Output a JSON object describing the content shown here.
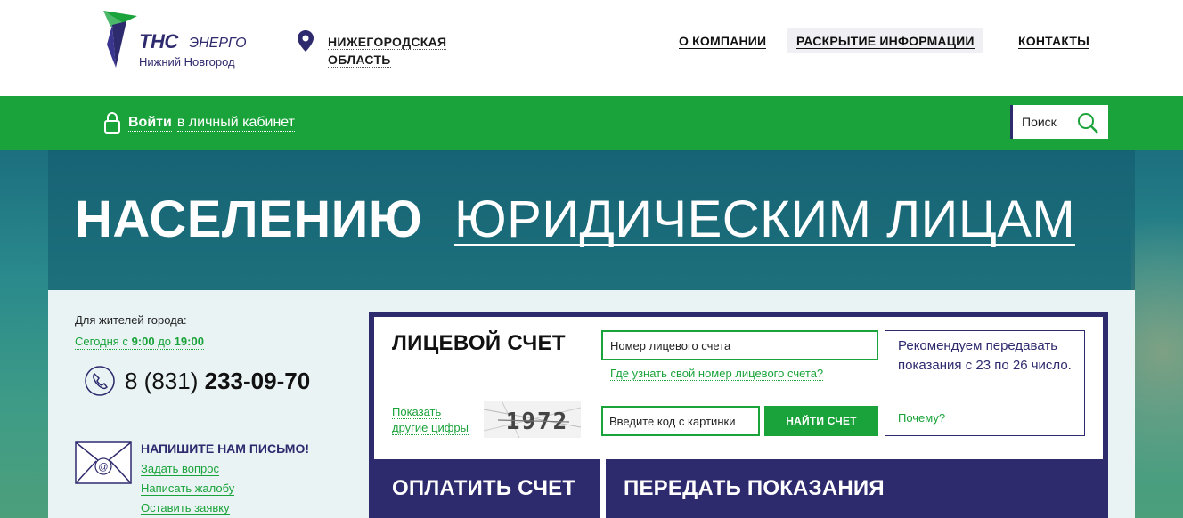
{
  "header": {
    "logo": {
      "brand": "ТНС",
      "brand_suffix": "ЭНЕРГО",
      "city": "Нижний Новгород"
    },
    "region": {
      "line1": "НИЖЕГОРОДСКАЯ",
      "line2": "ОБЛАСТЬ",
      "icon": "location-pin-icon"
    },
    "nav": [
      {
        "label": "О КОМПАНИИ"
      },
      {
        "label": "РАСКРЫТИЕ ИНФОРМАЦИИ"
      },
      {
        "label": "КОНТАКТЫ"
      }
    ]
  },
  "greenbar": {
    "login_strong": "Войти",
    "login_rest": "в личный кабинет",
    "search_placeholder": "Поиск"
  },
  "hero": {
    "tab_active": "НАСЕЛЕНИЮ",
    "tab_other": "ЮРИДИЧЕСКИМ ЛИЦАМ"
  },
  "contacts": {
    "label": "Для жителей города:",
    "hours_prefix": "Сегодня с",
    "hours_from": "9:00",
    "hours_mid": "до",
    "hours_to": "19:00",
    "phone_code": "8 (831)",
    "phone_number": "233-09-70",
    "mail_title": "НАПИШИТЕ НАМ ПИСЬМО!",
    "mail_links": [
      "Задать вопрос",
      "Написать жалобу",
      "Оставить заявку"
    ]
  },
  "account": {
    "title": "ЛИЦЕВОЙ СЧЕТ",
    "account_placeholder": "Номер лицевого счета",
    "help_link": "Где узнать свой номер лицевого счета?",
    "captcha_refresh_line1": "Показать",
    "captcha_refresh_line2": "другие цифры",
    "captcha_code": "1972",
    "captcha_placeholder": "Введите код с картинки",
    "find_button": "НАЙТИ СЧЕТ",
    "recommend_text": "Рекомендуем передавать показания с 23 по 26 число.",
    "recommend_link": "Почему?"
  },
  "actions": {
    "pay": "ОПЛАТИТЬ СЧЕТ",
    "meter": "ПЕРЕДАТЬ ПОКАЗАНИЯ"
  },
  "colors": {
    "brand_green": "#1aa33a",
    "brand_indigo": "#2e2a6e"
  }
}
